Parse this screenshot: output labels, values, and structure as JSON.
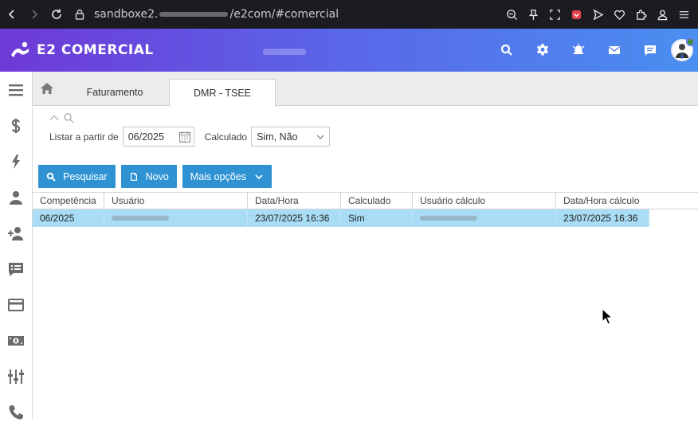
{
  "browser": {
    "url_prefix": "sandboxe2.",
    "url_suffix": "/e2com/#comercial"
  },
  "app": {
    "logo_text": "E2 COMERCIAL"
  },
  "tabs": [
    {
      "label": "Faturamento"
    },
    {
      "label": "DMR - TSEE"
    }
  ],
  "filters": {
    "date_label": "Listar a partir de",
    "date_value": "06/2025",
    "calc_label": "Calculado",
    "calc_value": "Sim, Não"
  },
  "buttons": {
    "search": "Pesquisar",
    "new": "Novo",
    "more": "Mais opções"
  },
  "table": {
    "columns": [
      "Competência",
      "Usuário",
      "Data/Hora",
      "Calculado",
      "Usuário cálculo",
      "Data/Hora cálculo"
    ],
    "rows": [
      {
        "competencia": "06/2025",
        "data_hora": "23/07/2025 16:36",
        "calculado": "Sim",
        "data_hora_calculo": "23/07/2025 16:36"
      }
    ]
  },
  "colors": {
    "header_gradient_start": "#6f39d6",
    "header_gradient_end": "#4a8ff0",
    "button_blue": "#2f93d3",
    "selected_row": "#a9ddf5"
  },
  "icons": {
    "sidebar": [
      "menu-icon",
      "dollar-icon",
      "bolt-icon",
      "user-icon",
      "user-plus-icon",
      "list-alt-icon",
      "credit-card-icon",
      "money-icon",
      "equalizer-icon",
      "phone-icon"
    ]
  }
}
